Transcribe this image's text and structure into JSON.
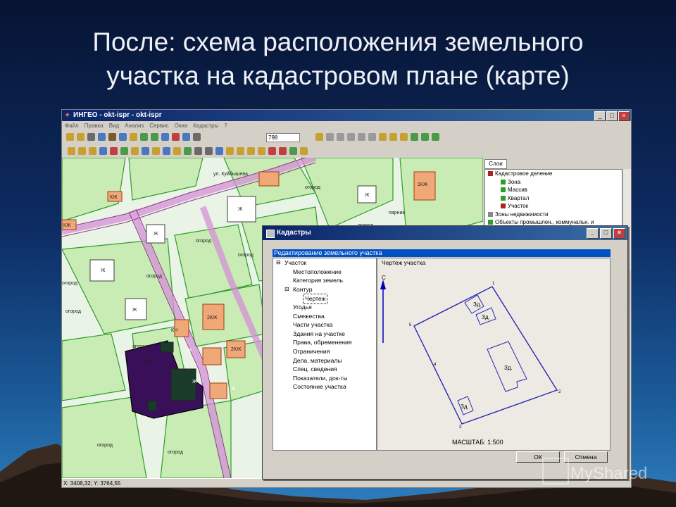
{
  "slide": {
    "title_line1": "После: схема расположения земельного",
    "title_line2": "участка на кадастровом плане (карте)"
  },
  "app": {
    "title": "ИНГЕО - okt-ispr - okt-ispr",
    "menu": [
      "Файл",
      "Правка",
      "Вид",
      "Анализ",
      "Сервис",
      "Окна",
      "Кадастры",
      "?"
    ],
    "zoom_value": "798",
    "status_coords": "X: 3408,32; Y: 3764,55"
  },
  "layers": {
    "tab_label": "Слои",
    "items": [
      {
        "label": "Кадастровое деление",
        "icon": "folder-icon",
        "color": "#b02020"
      },
      {
        "label": "Зона",
        "icon": "layer-icon",
        "color": "#2c9c2c"
      },
      {
        "label": "Массив",
        "icon": "layer-icon",
        "color": "#2c9c2c"
      },
      {
        "label": "Квартал",
        "icon": "layer-icon",
        "color": "#2c9c2c"
      },
      {
        "label": "Участок",
        "icon": "layer-icon",
        "color": "#b02020"
      },
      {
        "label": "Зоны недвижимости",
        "icon": "folder-icon",
        "color": "#888888"
      },
      {
        "label": "Объекты промышлен., коммунальн. и",
        "icon": "folder-icon",
        "color": "#2c9c2c"
      }
    ]
  },
  "map": {
    "labels": [
      {
        "text": "огород"
      },
      {
        "text": "огород"
      },
      {
        "text": "огород"
      },
      {
        "text": "огород"
      },
      {
        "text": "огород"
      },
      {
        "text": "огород"
      },
      {
        "text": "огород"
      },
      {
        "text": "огород"
      },
      {
        "text": "огород"
      },
      {
        "text": "огород"
      },
      {
        "text": "огород"
      },
      {
        "text": "огород"
      },
      {
        "text": "Ж"
      },
      {
        "text": "Ж"
      },
      {
        "text": "Ж"
      },
      {
        "text": "Ж"
      },
      {
        "text": "Ж"
      },
      {
        "text": "Ж"
      },
      {
        "text": "Ж"
      },
      {
        "text": "Ж"
      },
      {
        "text": "КЖ"
      },
      {
        "text": "КЖ"
      },
      {
        "text": "КН"
      },
      {
        "text": "1КЖ"
      },
      {
        "text": "2КЖ"
      },
      {
        "text": "2КЖ"
      },
      {
        "text": "ул. Куйбышева"
      },
      {
        "text": "парник"
      }
    ]
  },
  "dialog": {
    "title": "Кадастры",
    "header": "Редактирование земельного участка",
    "tree": [
      {
        "label": "Участок",
        "mark": "−",
        "level": 0
      },
      {
        "label": "Местоположение",
        "mark": "",
        "level": 1
      },
      {
        "label": "Категория земель",
        "mark": "",
        "level": 1
      },
      {
        "label": "Контур",
        "mark": "−",
        "level": 1
      },
      {
        "label": "Чертеж",
        "mark": "",
        "level": 2,
        "selected": true
      },
      {
        "label": "Угодья",
        "mark": "",
        "level": 1
      },
      {
        "label": "Смежества",
        "mark": "",
        "level": 1
      },
      {
        "label": "Части участка",
        "mark": "",
        "level": 1
      },
      {
        "label": "Здания на участке",
        "mark": "",
        "level": 1
      },
      {
        "label": "Права, обременения",
        "mark": "",
        "level": 1
      },
      {
        "label": "Ограничения",
        "mark": "",
        "level": 1
      },
      {
        "label": "Дела, материалы",
        "mark": "",
        "level": 1
      },
      {
        "label": "Спец. сведения",
        "mark": "",
        "level": 1
      },
      {
        "label": "Показатели, док-ты",
        "mark": "",
        "level": 1
      },
      {
        "label": "Состояние участка",
        "mark": "",
        "level": 1
      }
    ],
    "drawing_label": "Чертеж участка",
    "north_label": "С",
    "scale_text": "МАСШТАБ: 1:500",
    "building_label": "Зд.",
    "vertex_labels": [
      "1",
      "2",
      "3",
      "4",
      "5"
    ],
    "ok_label": "ОК",
    "cancel_label": "Отмена"
  },
  "watermark": "MyShared"
}
